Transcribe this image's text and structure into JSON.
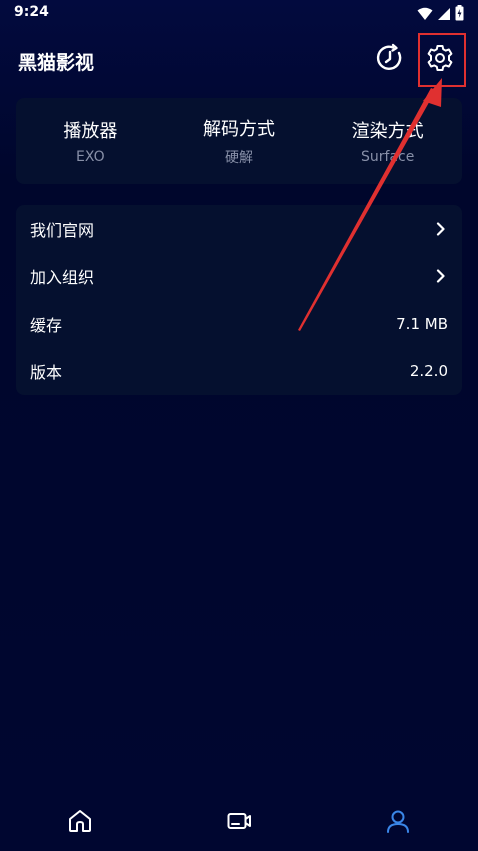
{
  "status_bar": {
    "time": "9:24"
  },
  "header": {
    "title": "黑猫影视",
    "history_icon": "history-icon",
    "settings_icon": "gear-icon"
  },
  "info": [
    {
      "title": "播放器",
      "value": "EXO"
    },
    {
      "title": "解码方式",
      "value": "硬解"
    },
    {
      "title": "渲染方式",
      "value": "Surface"
    }
  ],
  "menu": {
    "official_site": "我们官网",
    "join_group": "加入组织",
    "cache_label": "缓存",
    "cache_value": "7.1 MB",
    "version_label": "版本",
    "version_value": "2.2.0"
  },
  "bottom_nav": [
    {
      "icon": "home-icon",
      "active": false
    },
    {
      "icon": "video-icon",
      "active": false
    },
    {
      "icon": "user-icon",
      "active": true
    }
  ],
  "colors": {
    "background": "#000732",
    "card": "#05102f",
    "accent": "#3a86e8",
    "annotation": "#e03030",
    "muted_text": "#8890a8"
  }
}
